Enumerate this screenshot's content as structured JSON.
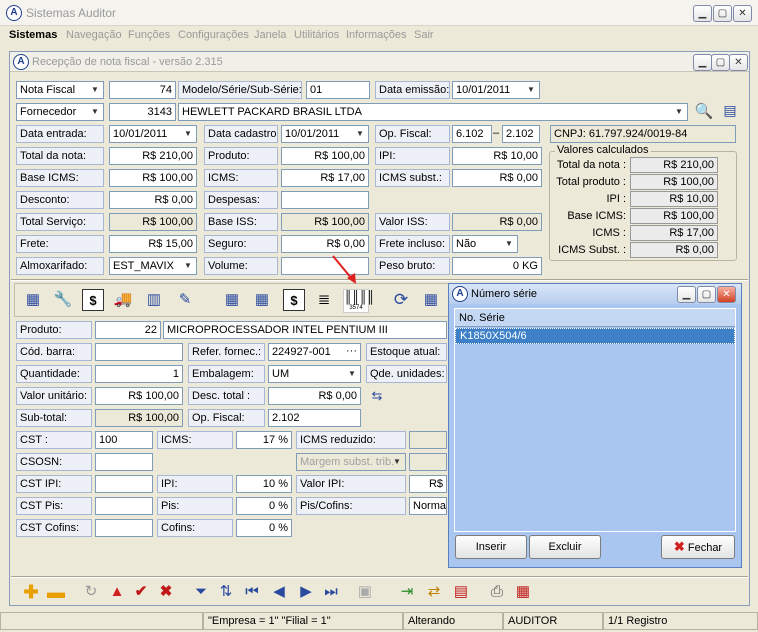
{
  "app": {
    "title": "Sistemas Auditor"
  },
  "menu": [
    "Sistemas",
    "Navegação",
    "Funções",
    "Configurações",
    "Janela",
    "Utilitários",
    "Informações",
    "Sair"
  ],
  "nota": {
    "title": "Recepção de nota fiscal - versão 2.315",
    "tipo": "Nota Fiscal",
    "numero": "74",
    "modelo_label": "Modelo/Série/Sub-Série:",
    "modelo": "01",
    "data_emissao_label": "Data emissão:",
    "data_emissao": "10/01/2011",
    "fornecedor_label": "Fornecedor",
    "fornecedor_cod": "3143",
    "fornecedor_nome": "HEWLETT PACKARD BRASIL LTDA",
    "data_entrada_label": "Data entrada:",
    "data_entrada": "10/01/2011",
    "data_cadastro_label": "Data cadastro:",
    "data_cadastro": "10/01/2011",
    "op_fiscal_label": "Op. Fiscal:",
    "op_fiscal_1": "6.102",
    "op_fiscal_sep": "–",
    "op_fiscal_2": "2.102",
    "cnpj": "CNPJ: 61.797.924/0019-84",
    "total_nota_label": "Total da nota:",
    "total_nota": "R$ 210,00",
    "produto_label": "Produto:",
    "produto": "R$ 100,00",
    "ipi_label": "IPI:",
    "ipi": "R$ 10,00",
    "base_icms_label": "Base ICMS:",
    "base_icms": "R$ 100,00",
    "icms_label": "ICMS:",
    "icms": "R$ 17,00",
    "icms_subst_label": "ICMS subst.:",
    "icms_subst": "R$ 0,00",
    "desconto_label": "Desconto:",
    "desconto": "R$ 0,00",
    "despesas_label": "Despesas:",
    "despesas": "",
    "total_servico_label": "Total Serviço:",
    "total_servico": "R$ 100,00",
    "base_iss_label": "Base ISS:",
    "base_iss": "R$ 100,00",
    "valor_iss_label": "Valor ISS:",
    "valor_iss": "R$ 0,00",
    "frete_label": "Frete:",
    "frete": "R$ 15,00",
    "seguro_label": "Seguro:",
    "seguro": "R$ 0,00",
    "frete_incluso_label": "Frete incluso:",
    "frete_incluso": "Não",
    "almoxarifado_label": "Almoxarifado:",
    "almoxarifado": "EST_MAVIX",
    "volume_label": "Volume:",
    "volume": "",
    "peso_bruto_label": "Peso bruto:",
    "peso_bruto": "0 KG"
  },
  "calc": {
    "title": "Valores calculados",
    "rows": [
      {
        "label": "Total da nota :",
        "value": "R$ 210,00"
      },
      {
        "label": "Total produto :",
        "value": "R$ 100,00"
      },
      {
        "label": "IPI :",
        "value": "R$ 10,00"
      },
      {
        "label": "Base ICMS:",
        "value": "R$ 100,00"
      },
      {
        "label": "ICMS :",
        "value": "R$ 17,00"
      },
      {
        "label": "ICMS Subst. :",
        "value": "R$ 0,00"
      }
    ]
  },
  "item": {
    "produto_label": "Produto:",
    "produto_cod": "22",
    "produto_nome": "MICROPROCESSADOR INTEL PENTIUM III",
    "cod_barra_label": "Cód. barra:",
    "cod_barra": "",
    "refer_label": "Refer. fornec.:",
    "refer": "224927-001",
    "refer_btn": "···",
    "estoque_label": "Estoque atual:",
    "quantidade_label": "Quantidade:",
    "quantidade": "1",
    "embalagem_label": "Embalagem:",
    "embalagem": "UM",
    "qde_unidades_label": "Qde. unidades:",
    "valor_unit_label": "Valor unitário:",
    "valor_unit": "R$ 100,00",
    "desc_total_label": "Desc. total :",
    "desc_total": "R$ 0,00",
    "subtotal_label": "Sub-total:",
    "subtotal": "R$ 100,00",
    "op_fiscal_label": "Op. Fiscal:",
    "op_fiscal": "2.102",
    "cst_label": "CST :",
    "cst": "100",
    "icms_label": "ICMS:",
    "icms": "17 %",
    "icms_red_label": "ICMS reduzido:",
    "csosn_label": "CSOSN:",
    "csosn": "",
    "margem_label": "Margem subst. trib.",
    "cst_ipi_label": "CST  IPI:",
    "cst_ipi": "",
    "ipi_label": "IPI:",
    "ipi": "10 %",
    "valor_ipi_label": "Valor IPI:",
    "valor_ipi": "R$",
    "cst_pis_label": "CST  Pis:",
    "cst_pis": "",
    "pis_label": "Pis:",
    "pis": "0 %",
    "pis_cofins_label": "Pis/Cofins:",
    "pis_cofins": "Normal",
    "cst_cofins_label": "CST Cofins:",
    "cst_cofins": "",
    "cofins_label": "Cofins:",
    "cofins": "0 %"
  },
  "barcode_icon_text": "3574",
  "serie": {
    "title": "Número série",
    "column": "No. Série",
    "rows": [
      "K1850X504/6"
    ],
    "inserir": "Inserir",
    "excluir": "Excluir",
    "fechar": "Fechar"
  },
  "status": {
    "empresa": "\"Empresa = 1\"  \"Filial = 1\"",
    "modo": "Alterando",
    "usuario": "AUDITOR",
    "registro": "1/1 Registro"
  },
  "colors": {
    "selection": "#3d80c8",
    "panel_blue": "#a9c6f0",
    "arrow_red": "#e02020"
  }
}
